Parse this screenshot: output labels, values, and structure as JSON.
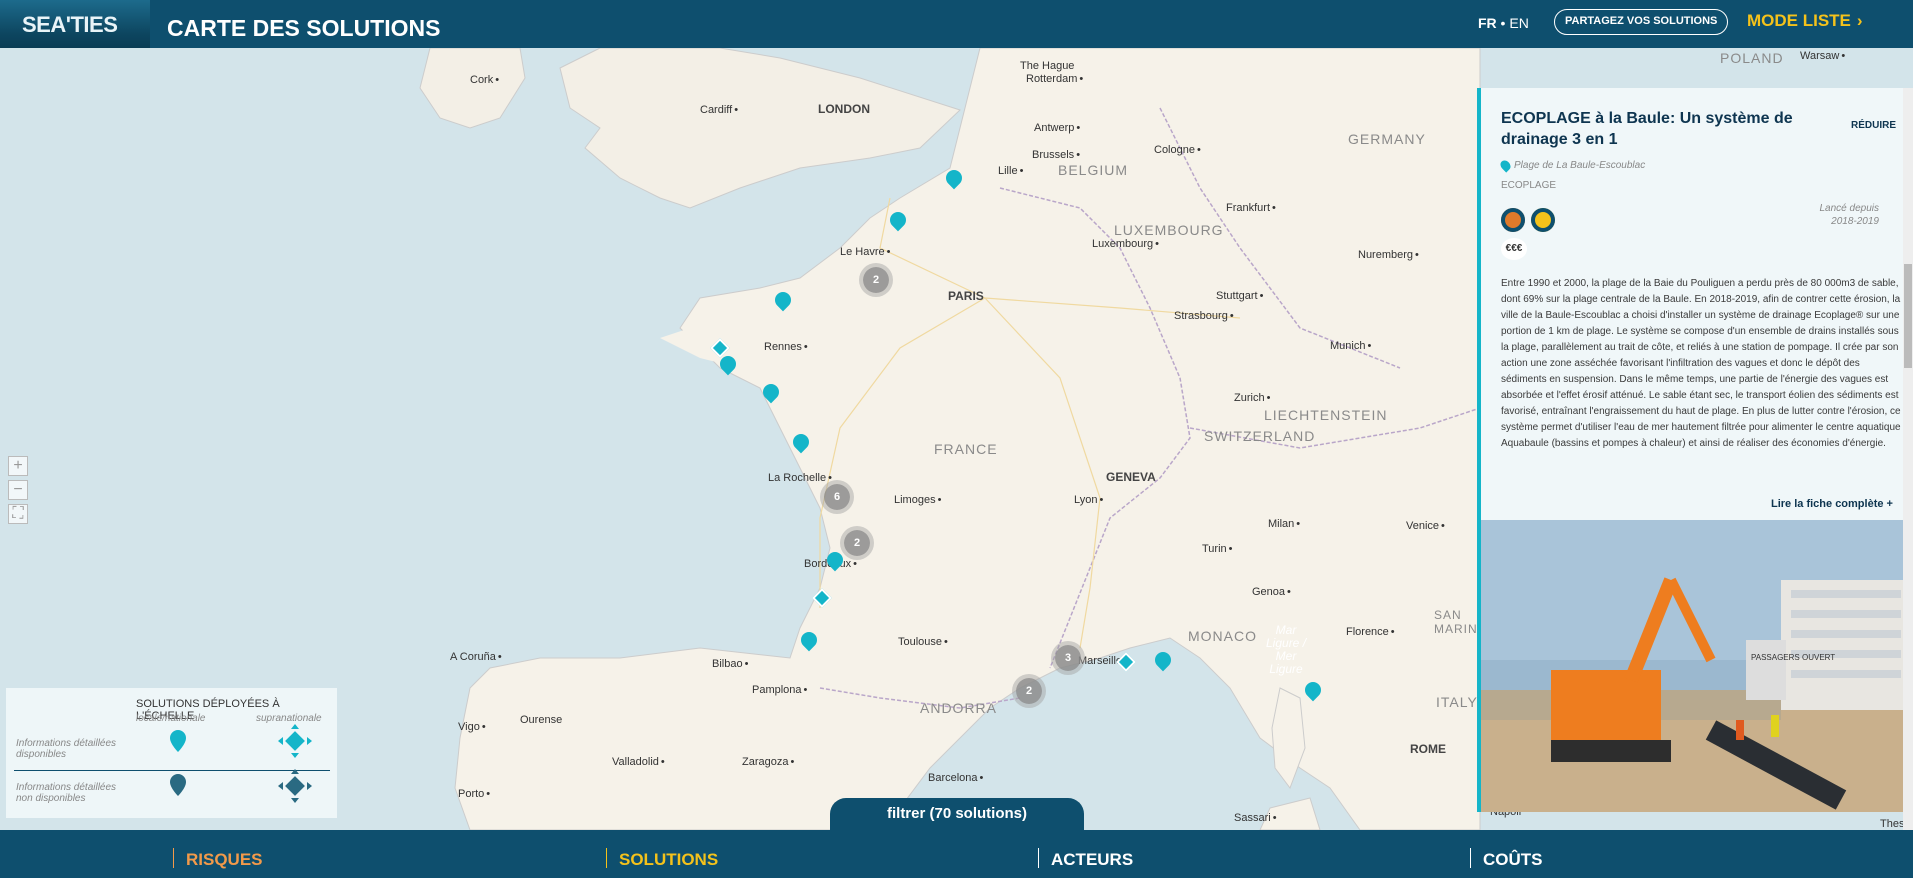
{
  "header": {
    "logo": "SEA'TIES",
    "title": "CARTE DES SOLUTIONS",
    "lang_fr": "FR",
    "lang_sep": " • ",
    "lang_en": "EN",
    "share_label": "PARTAGEZ VOS SOLUTIONS",
    "mode_label": "MODE LISTE",
    "mode_icon": "chevron-right-icon"
  },
  "map": {
    "zoom_in": "+",
    "zoom_out": "−",
    "fullscreen": "⛶",
    "places": [
      {
        "id": "cork",
        "label": "Cork",
        "type": "city"
      },
      {
        "id": "cardiff",
        "label": "Cardiff",
        "type": "city"
      },
      {
        "id": "london",
        "label": "LONDON",
        "type": "capital"
      },
      {
        "id": "hague",
        "label": "The Hague",
        "type": "city"
      },
      {
        "id": "rotterdam",
        "label": "Rotterdam",
        "type": "city"
      },
      {
        "id": "antwerp",
        "label": "Antwerp",
        "type": "city"
      },
      {
        "id": "brussels",
        "label": "Brussels",
        "type": "city"
      },
      {
        "id": "lille",
        "label": "Lille",
        "type": "city"
      },
      {
        "id": "belgium",
        "label": "BELGIUM",
        "type": "country"
      },
      {
        "id": "cologne",
        "label": "Cologne",
        "type": "city"
      },
      {
        "id": "germany",
        "label": "GERMANY",
        "type": "country"
      },
      {
        "id": "poland",
        "label": "POLAND",
        "type": "country"
      },
      {
        "id": "warsaw",
        "label": "Warsaw",
        "type": "city"
      },
      {
        "id": "frankfurt",
        "label": "Frankfurt",
        "type": "city"
      },
      {
        "id": "luxembourg_c",
        "label": "LUXEMBOURG",
        "type": "country"
      },
      {
        "id": "luxembourg",
        "label": "Luxembourg",
        "type": "city"
      },
      {
        "id": "nuremberg",
        "label": "Nuremberg",
        "type": "city"
      },
      {
        "id": "lehavre",
        "label": "Le Havre",
        "type": "city"
      },
      {
        "id": "paris",
        "label": "PARIS",
        "type": "capital"
      },
      {
        "id": "stuttgart",
        "label": "Stuttgart",
        "type": "city"
      },
      {
        "id": "strasbourg",
        "label": "Strasbourg",
        "type": "city"
      },
      {
        "id": "rennes",
        "label": "Rennes",
        "type": "city"
      },
      {
        "id": "munich",
        "label": "Munich",
        "type": "city"
      },
      {
        "id": "zurich",
        "label": "Zurich",
        "type": "city"
      },
      {
        "id": "liechtenstein",
        "label": "LIECHTENSTEIN",
        "type": "country"
      },
      {
        "id": "switzerland",
        "label": "SWITZERLAND",
        "type": "country"
      },
      {
        "id": "france",
        "label": "FRANCE",
        "type": "country"
      },
      {
        "id": "geneva",
        "label": "GENEVA",
        "type": "capital"
      },
      {
        "id": "larochelle",
        "label": "La Rochelle",
        "type": "city"
      },
      {
        "id": "limoges",
        "label": "Limoges",
        "type": "city"
      },
      {
        "id": "lyon",
        "label": "Lyon",
        "type": "city"
      },
      {
        "id": "milan",
        "label": "Milan",
        "type": "city"
      },
      {
        "id": "venice",
        "label": "Venice",
        "type": "city"
      },
      {
        "id": "bordeaux",
        "label": "Bordeaux",
        "type": "city"
      },
      {
        "id": "turin",
        "label": "Turin",
        "type": "city"
      },
      {
        "id": "genoa",
        "label": "Genoa",
        "type": "city"
      },
      {
        "id": "monaco",
        "label": "MONACO",
        "type": "country"
      },
      {
        "id": "florence",
        "label": "Florence",
        "type": "city"
      },
      {
        "id": "sanmarino",
        "label": "SAN\nMARINO",
        "type": "country"
      },
      {
        "id": "toulouse",
        "label": "Toulouse",
        "type": "city"
      },
      {
        "id": "coruna",
        "label": "A Coruña",
        "type": "city"
      },
      {
        "id": "bilbao",
        "label": "Bilbao",
        "type": "city"
      },
      {
        "id": "marseille",
        "label": "Marseille",
        "type": "city"
      },
      {
        "id": "ligure",
        "label": "Mar\nLigure /\nMer\nLigure",
        "type": "sea"
      },
      {
        "id": "ourense",
        "label": "Ourense",
        "type": "city"
      },
      {
        "id": "pamplona",
        "label": "Pamplona",
        "type": "city"
      },
      {
        "id": "andorra",
        "label": "ANDORRA",
        "type": "country"
      },
      {
        "id": "italy",
        "label": "ITALY",
        "type": "country"
      },
      {
        "id": "vigo",
        "label": "Vigo",
        "type": "city"
      },
      {
        "id": "valladolid",
        "label": "Valladolid",
        "type": "city"
      },
      {
        "id": "zaragoza",
        "label": "Zaragoza",
        "type": "city"
      },
      {
        "id": "rome",
        "label": "ROME",
        "type": "capital"
      },
      {
        "id": "barcelona",
        "label": "Barcelona",
        "type": "city"
      },
      {
        "id": "porto",
        "label": "Porto",
        "type": "city"
      },
      {
        "id": "sassari",
        "label": "Sassari",
        "type": "city"
      },
      {
        "id": "napoli",
        "label": "Napoli",
        "type": "city"
      },
      {
        "id": "thessaly",
        "label": "Thessal",
        "type": "city"
      }
    ],
    "clusters": [
      "2",
      "6",
      "2",
      "3",
      "2"
    ],
    "pin_color": "#14b5c9",
    "pin_dark_color": "#2a6a82"
  },
  "legend": {
    "title": "SOLUTIONS DÉPLOYÉES À L'ÉCHELLE",
    "col_local": "locale/nationale",
    "col_supra": "supranationale",
    "row_available": "Informations détaillées disponibles",
    "row_unavailable": "Informations détaillées non disponibles"
  },
  "filter": {
    "label": "filtrer (70 solutions)"
  },
  "panel": {
    "title": "ECOPLAGE à la Baule: Un système de drainage 3 en 1",
    "reduce_label": "RÉDUIRE",
    "location": "Plage de La Baule-Escoublac",
    "organization": "ECOPLAGE",
    "launch_label": "Lancé depuis",
    "launch_period": "2018-2019",
    "cost_label": "€€€",
    "description": "Entre 1990 et 2000, la plage de la Baie du Pouliguen a perdu près de 80 000m3 de sable, dont 69% sur la plage centrale de la Baule. En 2018-2019, afin de contrer cette érosion, la ville de la Baule-Escoublac a choisi d'installer un système de drainage Ecoplage® sur une portion de 1 km de plage. Le système se compose d'un ensemble de drains installés sous la plage, parallèlement au trait de côte, et reliés à une station de pompage. Il crée par son action une zone asséchée favorisant l'infiltration des vagues et donc le dépôt des sédiments en suspension. Dans le même temps, une partie de l'énergie des vagues est absorbée et l'effet érosif atténué. Le sable étant sec, le transport éolien des sédiments est favorisé, entraînant l'engraissement du haut de plage. En plus de lutter contre l'érosion, ce système permet d'utiliser l'eau de mer hautement filtrée pour alimenter le centre aquatique Aquabaule (bassins et pompes à chaleur) et ainsi de réaliser des économies d'énergie.",
    "more_label": "Lire la fiche complète",
    "more_icon": "plus-icon",
    "photo_sign": "PASSAGERS OUVERT"
  },
  "bottom_nav": [
    {
      "label": "RISQUES",
      "color": "#f29a4a"
    },
    {
      "label": "SOLUTIONS",
      "color": "#f4c21b"
    },
    {
      "label": "ACTEURS",
      "color": "#ffffff"
    },
    {
      "label": "COÛTS",
      "color": "#ffffff"
    }
  ],
  "colors": {
    "brand": "#0e4f6e",
    "accent": "#14b5c9",
    "yellow": "#f4c21b",
    "orange": "#f29a4a"
  }
}
